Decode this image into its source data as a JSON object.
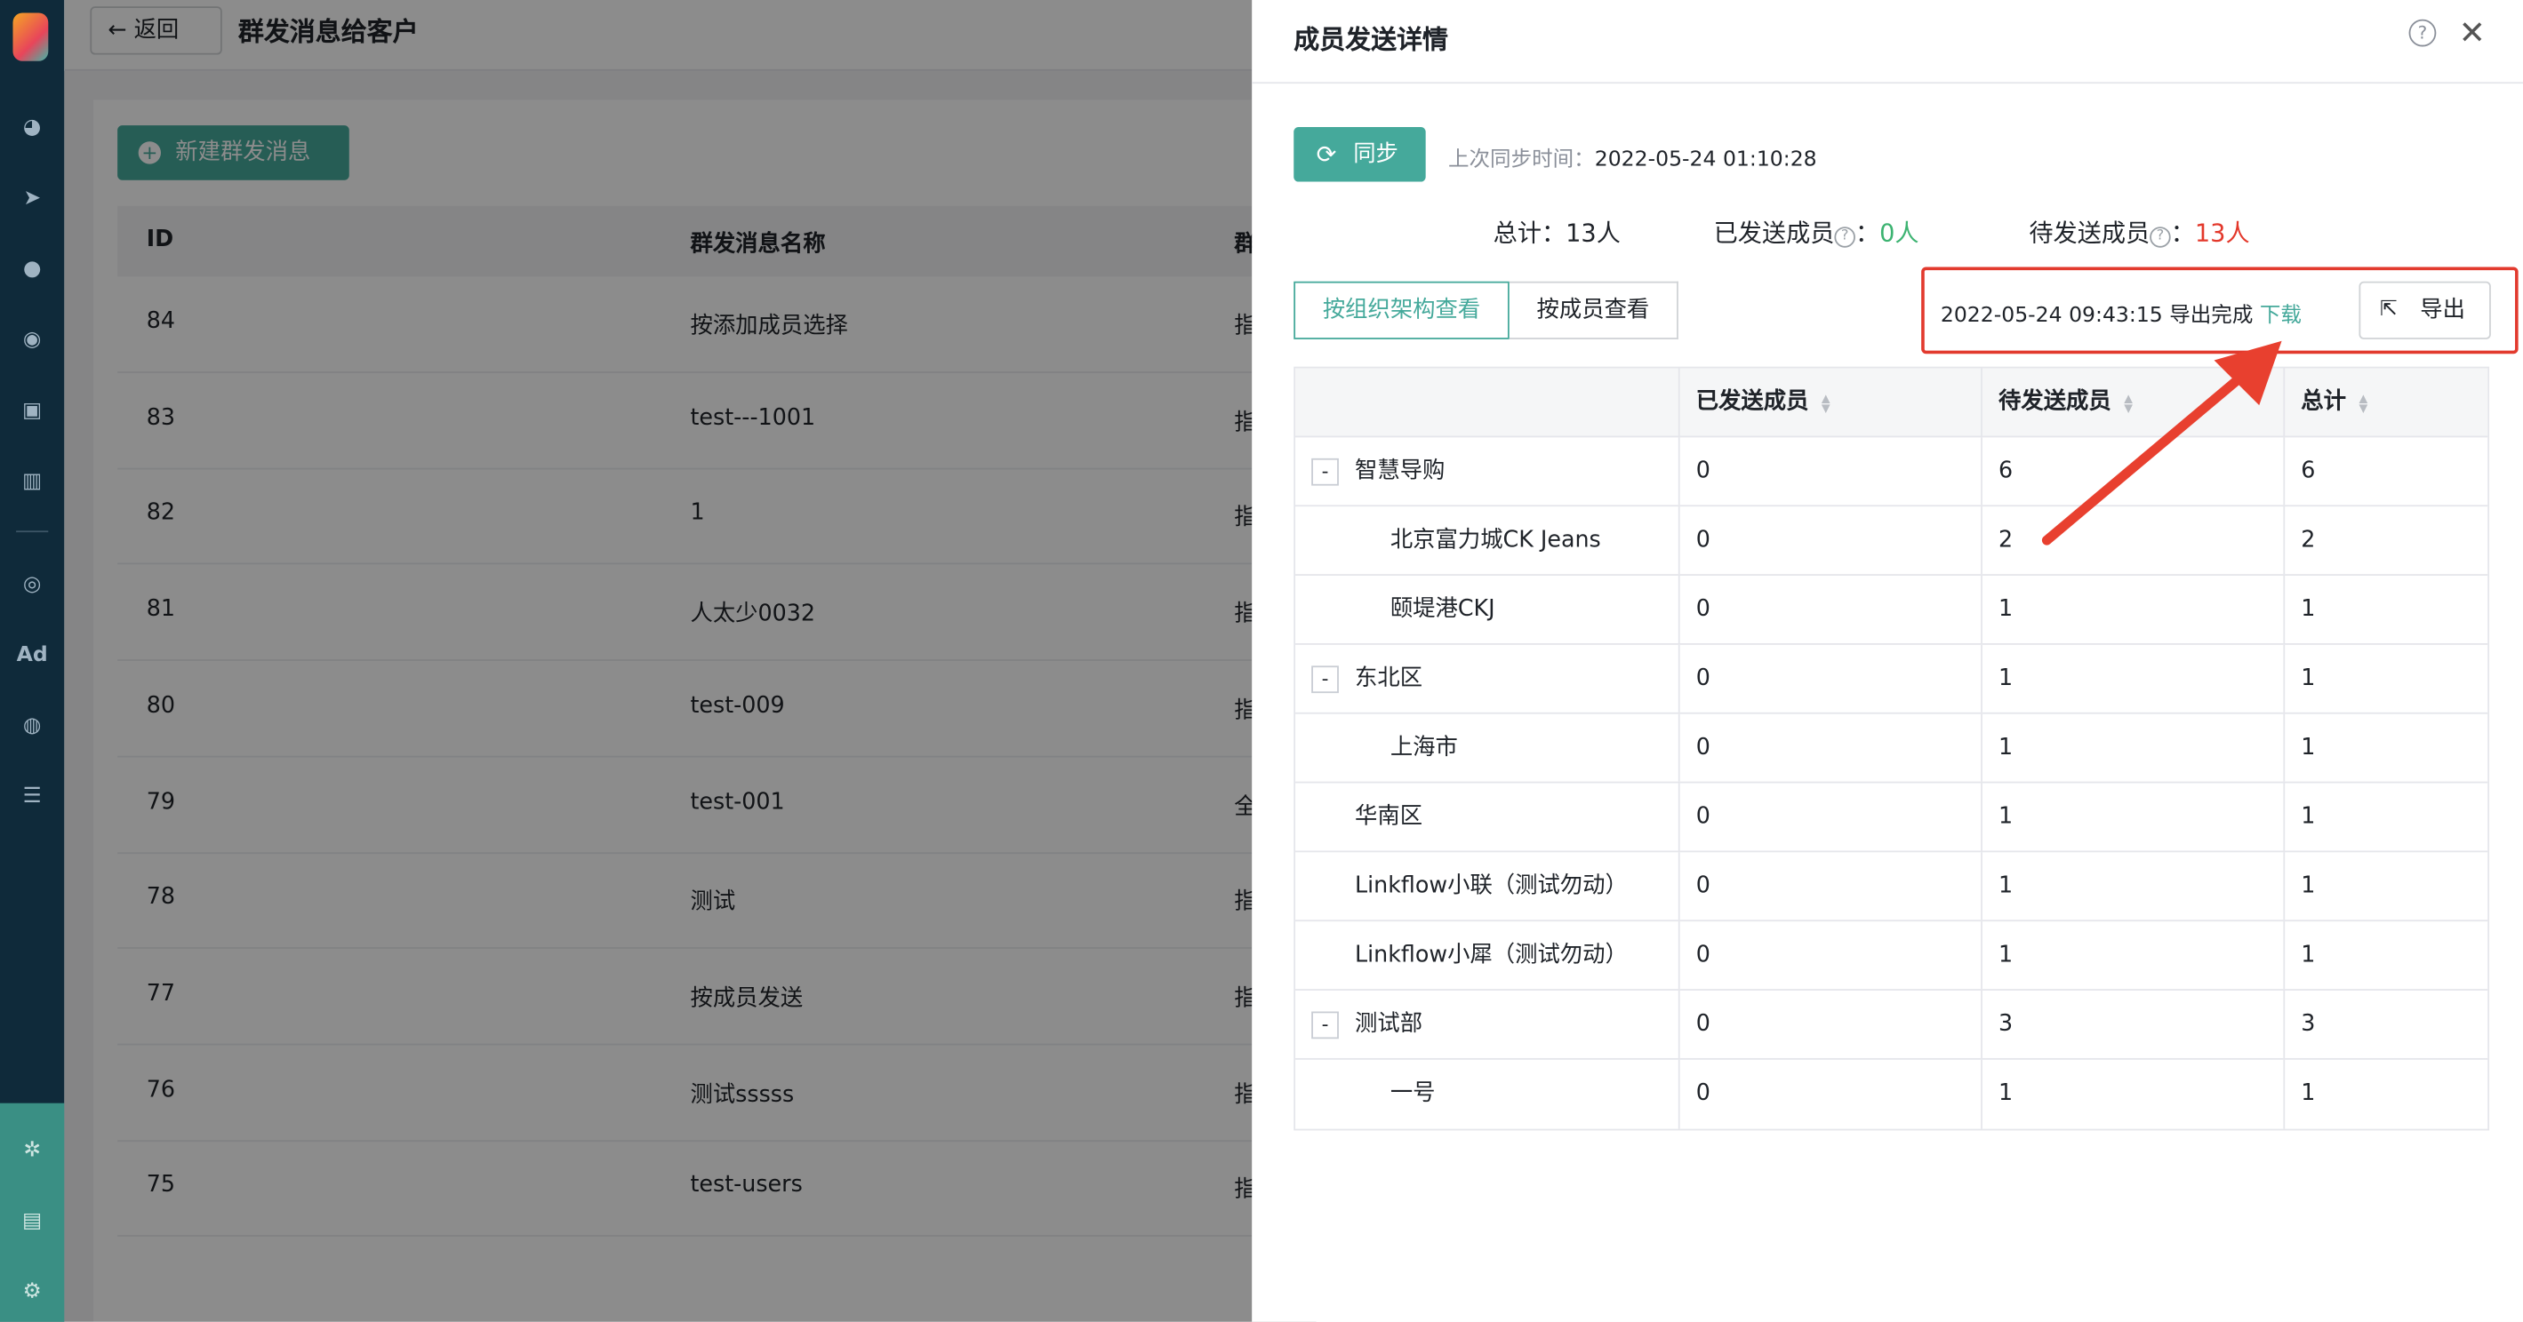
{
  "page": {
    "back_label": "返回",
    "title": "群发消息给客户",
    "new_button": "新建群发消息",
    "columns": [
      "ID",
      "群发消息名称",
      "群"
    ],
    "rows": [
      {
        "id": "84",
        "name": "按添加成员选择",
        "c3": "指"
      },
      {
        "id": "83",
        "name": "test---1001",
        "c3": "指"
      },
      {
        "id": "82",
        "name": "1",
        "c3": "指"
      },
      {
        "id": "81",
        "name": "人太少0032",
        "c3": "指"
      },
      {
        "id": "80",
        "name": "test-009",
        "c3": "指"
      },
      {
        "id": "79",
        "name": "test-001",
        "c3": "全"
      },
      {
        "id": "78",
        "name": "测试",
        "c3": "指"
      },
      {
        "id": "77",
        "name": "按成员发送",
        "c3": "指"
      },
      {
        "id": "76",
        "name": "测试sssss",
        "c3": "指"
      },
      {
        "id": "75",
        "name": "test-users",
        "c3": "指"
      }
    ]
  },
  "nav": {
    "icons": [
      "dashboard-icon",
      "send-icon",
      "user-icon",
      "users-icon",
      "bookmark-icon",
      "bar-chart-icon",
      "wechat-icon",
      "ad-icon",
      "target-icon",
      "list-icon",
      "share-icon",
      "server-icon",
      "gear-icon"
    ],
    "ad_text": "Ad"
  },
  "drawer": {
    "title": "成员发送详情",
    "sync_label": "同步",
    "sync_time_label": "上次同步时间：",
    "sync_time": "2022-05-24 01:10:28",
    "total_label": "总计：",
    "total_value": "13人",
    "sent_label": "已发送成员",
    "sent_value": "0人",
    "pending_label": "待发送成员",
    "pending_value": "13人",
    "tabs": [
      "按组织架构查看",
      "按成员查看"
    ],
    "export_status": "2022-05-24 09:43:15 导出完成",
    "download_label": "下载",
    "export_label": "导出",
    "table": {
      "headers": [
        "",
        "已发送成员",
        "待发送成员",
        "总计"
      ],
      "rows": [
        {
          "name": "智慧导购",
          "level": 0,
          "expandable": true,
          "sent": "0",
          "pending": "6",
          "total": "6"
        },
        {
          "name": "北京富力城CK Jeans",
          "level": 1,
          "expandable": false,
          "sent": "0",
          "pending": "2",
          "total": "2"
        },
        {
          "name": "颐堤港CKJ",
          "level": 1,
          "expandable": false,
          "sent": "0",
          "pending": "1",
          "total": "1"
        },
        {
          "name": "东北区",
          "level": 0,
          "expandable": true,
          "sent": "0",
          "pending": "1",
          "total": "1"
        },
        {
          "name": "上海市",
          "level": 1,
          "expandable": false,
          "sent": "0",
          "pending": "1",
          "total": "1"
        },
        {
          "name": "华南区",
          "level": 0,
          "expandable": false,
          "sent": "0",
          "pending": "1",
          "total": "1"
        },
        {
          "name": "Linkflow小联（测试勿动）",
          "level": 0,
          "expandable": false,
          "sent": "0",
          "pending": "1",
          "total": "1"
        },
        {
          "name": "Linkflow小犀（测试勿动）",
          "level": 0,
          "expandable": false,
          "sent": "0",
          "pending": "1",
          "total": "1"
        },
        {
          "name": "测试部",
          "level": 0,
          "expandable": true,
          "sent": "0",
          "pending": "3",
          "total": "3"
        },
        {
          "name": "一号",
          "level": 1,
          "expandable": false,
          "sent": "0",
          "pending": "1",
          "total": "1"
        }
      ]
    }
  },
  "colors": {
    "accent": "#45a99b",
    "highlight": "#e23a2e",
    "sent": "#3cb371",
    "pending": "#e3382b"
  }
}
